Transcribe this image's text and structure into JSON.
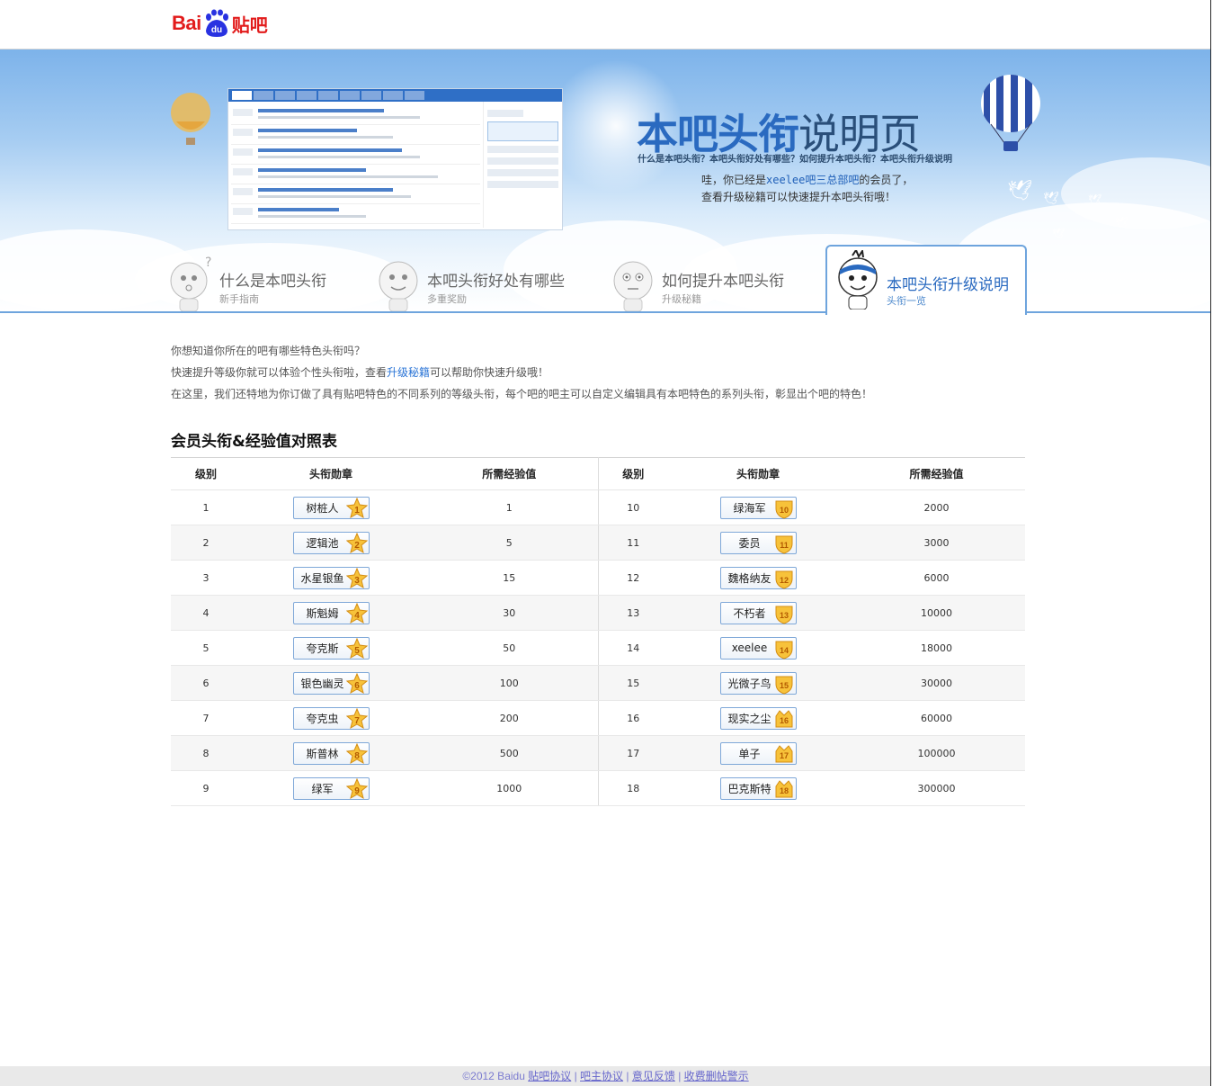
{
  "header": {
    "logo_bai": "Bai",
    "logo_du": "du",
    "logo_tieba": "贴吧"
  },
  "banner": {
    "title_main": "本吧头衔",
    "title_rest": "说明页",
    "subtitle": "什么是本吧头衔？本吧头衔好处有哪些？如何提升本吧头衔？本吧头衔升级说明",
    "msg_pre": "哇，你已经是",
    "msg_name": "xeelee",
    "msg_bar": "吧三总部吧",
    "msg_post": "的会员了，查看升级秘籍可以快速提升本吧头衔哦！"
  },
  "tabs": [
    {
      "label": "什么是本吧头衔",
      "sub": "新手指南"
    },
    {
      "label": "本吧头衔好处有哪些",
      "sub": "多重奖励"
    },
    {
      "label": "如何提升本吧头衔",
      "sub": "升级秘籍"
    },
    {
      "label": "本吧头衔升级说明",
      "sub": "头衔一览"
    }
  ],
  "intro": {
    "line1": "你想知道你所在的吧有哪些特色头衔吗？",
    "line2_pre": "快速提升等级你就可以体验个性头衔啦，查看",
    "line2_link": "升级秘籍",
    "line2_post": "可以帮助你快速升级哦！",
    "line3": "在这里，我们还特地为你订做了具有贴吧特色的不同系列的等级头衔，每个吧的吧主可以自定义编辑具有本吧特色的系列头衔，彰显出个吧的特色！"
  },
  "section_title": "会员头衔&经验值对照表",
  "table": {
    "headers": [
      "级别",
      "头衔勋章",
      "所需经验值",
      "级别",
      "头衔勋章",
      "所需经验值"
    ],
    "rows": [
      {
        "l1": "1",
        "t1": "树桩人",
        "e1": "1",
        "l2": "10",
        "t2": "绿海军",
        "e2": "2000"
      },
      {
        "l1": "2",
        "t1": "逻辑池",
        "e1": "5",
        "l2": "11",
        "t2": "委员",
        "e2": "3000"
      },
      {
        "l1": "3",
        "t1": "水星银鱼",
        "e1": "15",
        "l2": "12",
        "t2": "魏格纳友",
        "e2": "6000"
      },
      {
        "l1": "4",
        "t1": "斯魁姆",
        "e1": "30",
        "l2": "13",
        "t2": "不朽者",
        "e2": "10000"
      },
      {
        "l1": "5",
        "t1": "夸克斯",
        "e1": "50",
        "l2": "14",
        "t2": "xeelee",
        "e2": "18000"
      },
      {
        "l1": "6",
        "t1": "银色幽灵",
        "e1": "100",
        "l2": "15",
        "t2": "光微子鸟",
        "e2": "30000"
      },
      {
        "l1": "7",
        "t1": "夸克虫",
        "e1": "200",
        "l2": "16",
        "t2": "现实之尘",
        "e2": "60000"
      },
      {
        "l1": "8",
        "t1": "斯普林",
        "e1": "500",
        "l2": "17",
        "t2": "单子",
        "e2": "100000"
      },
      {
        "l1": "9",
        "t1": "绿军",
        "e1": "1000",
        "l2": "18",
        "t2": "巴克斯特",
        "e2": "300000"
      }
    ]
  },
  "footer": {
    "copyright": "©2012 Baidu",
    "links": [
      "贴吧协议",
      "吧主协议",
      "意见反馈",
      "收费删帖警示"
    ]
  },
  "colors": {
    "brand_red": "#e21b1b",
    "brand_blue": "#2a6ac0",
    "link": "#2a74d6"
  }
}
